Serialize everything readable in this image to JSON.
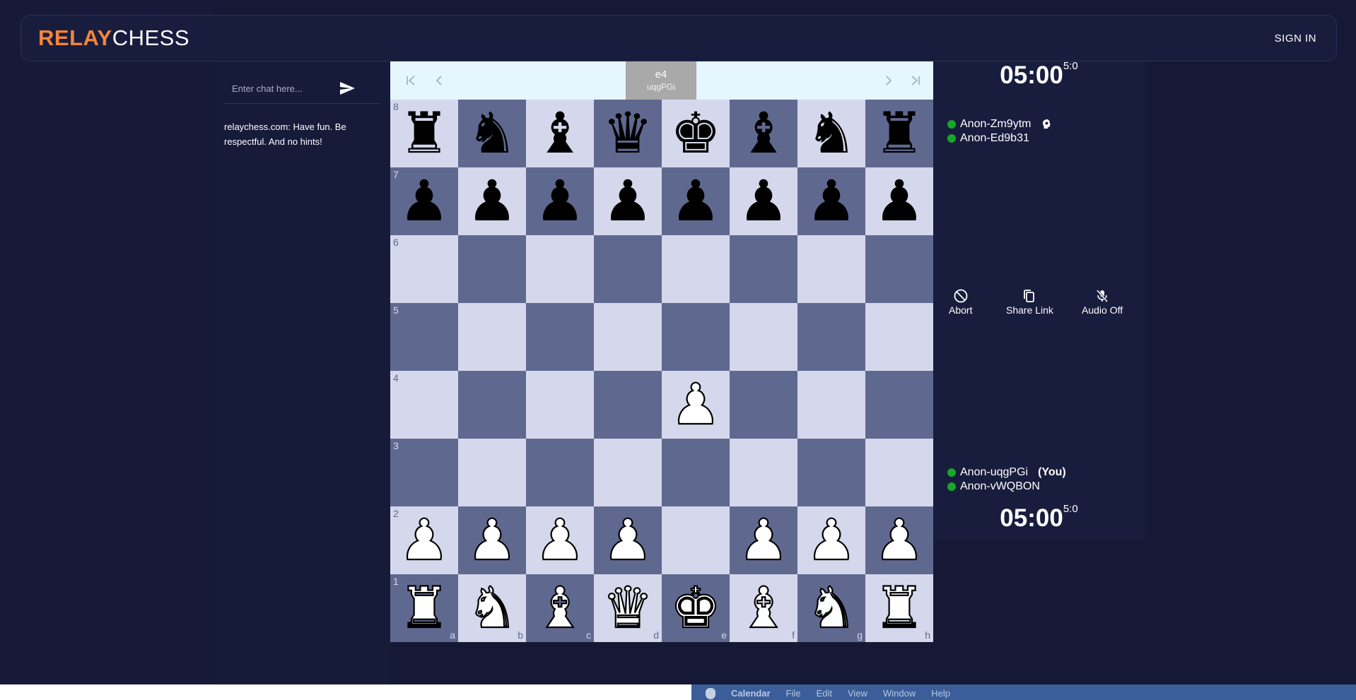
{
  "header": {
    "logo_relay": "RELAY",
    "logo_chess": "CHESS",
    "signin_label": "SIGN IN"
  },
  "chat": {
    "placeholder": "Enter chat here...",
    "messages": [
      "relaychess.com: Have fun. Be respectful. And no hints!"
    ]
  },
  "move_bar": {
    "current_move": "e4",
    "current_move_by": "uqgPGi"
  },
  "board": {
    "ranks": [
      "8",
      "7",
      "6",
      "5",
      "4",
      "3",
      "2",
      "1"
    ],
    "files": [
      "a",
      "b",
      "c",
      "d",
      "e",
      "f",
      "g",
      "h"
    ],
    "position": [
      [
        "bR",
        "bN",
        "bB",
        "bQ",
        "bK",
        "bB",
        "bN",
        "bR"
      ],
      [
        "bP",
        "bP",
        "bP",
        "bP",
        "bP",
        "bP",
        "bP",
        "bP"
      ],
      [
        "",
        "",
        "",
        "",
        "",
        "",
        "",
        ""
      ],
      [
        "",
        "",
        "",
        "",
        "",
        "",
        "",
        ""
      ],
      [
        "",
        "",
        "",
        "",
        "wP",
        "",
        "",
        ""
      ],
      [
        "",
        "",
        "",
        "",
        "",
        "",
        "",
        ""
      ],
      [
        "wP",
        "wP",
        "wP",
        "wP",
        "",
        "wP",
        "wP",
        "wP"
      ],
      [
        "wR",
        "wN",
        "wB",
        "wQ",
        "wK",
        "wB",
        "wN",
        "wR"
      ]
    ],
    "light_color": "#d5d8ec",
    "dark_color": "#5f6990"
  },
  "top_side": {
    "clock": "05:00",
    "increment": "5:0",
    "players": [
      "Anon-Zm9ytm",
      "Anon-Ed9b31"
    ]
  },
  "bottom_side": {
    "clock": "05:00",
    "increment": "5:0",
    "players": [
      "Anon-uqgPGi",
      "Anon-vWQBON"
    ],
    "you_label": "(You)"
  },
  "actions": {
    "abort": "Abort",
    "share_link": "Share Link",
    "audio_off": "Audio Off"
  },
  "os_menu": {
    "app": "Calendar",
    "items": [
      "File",
      "Edit",
      "View",
      "Window",
      "Help"
    ]
  },
  "colors": {
    "brand_orange": "#f4843d",
    "online_green": "#1aa52b"
  }
}
